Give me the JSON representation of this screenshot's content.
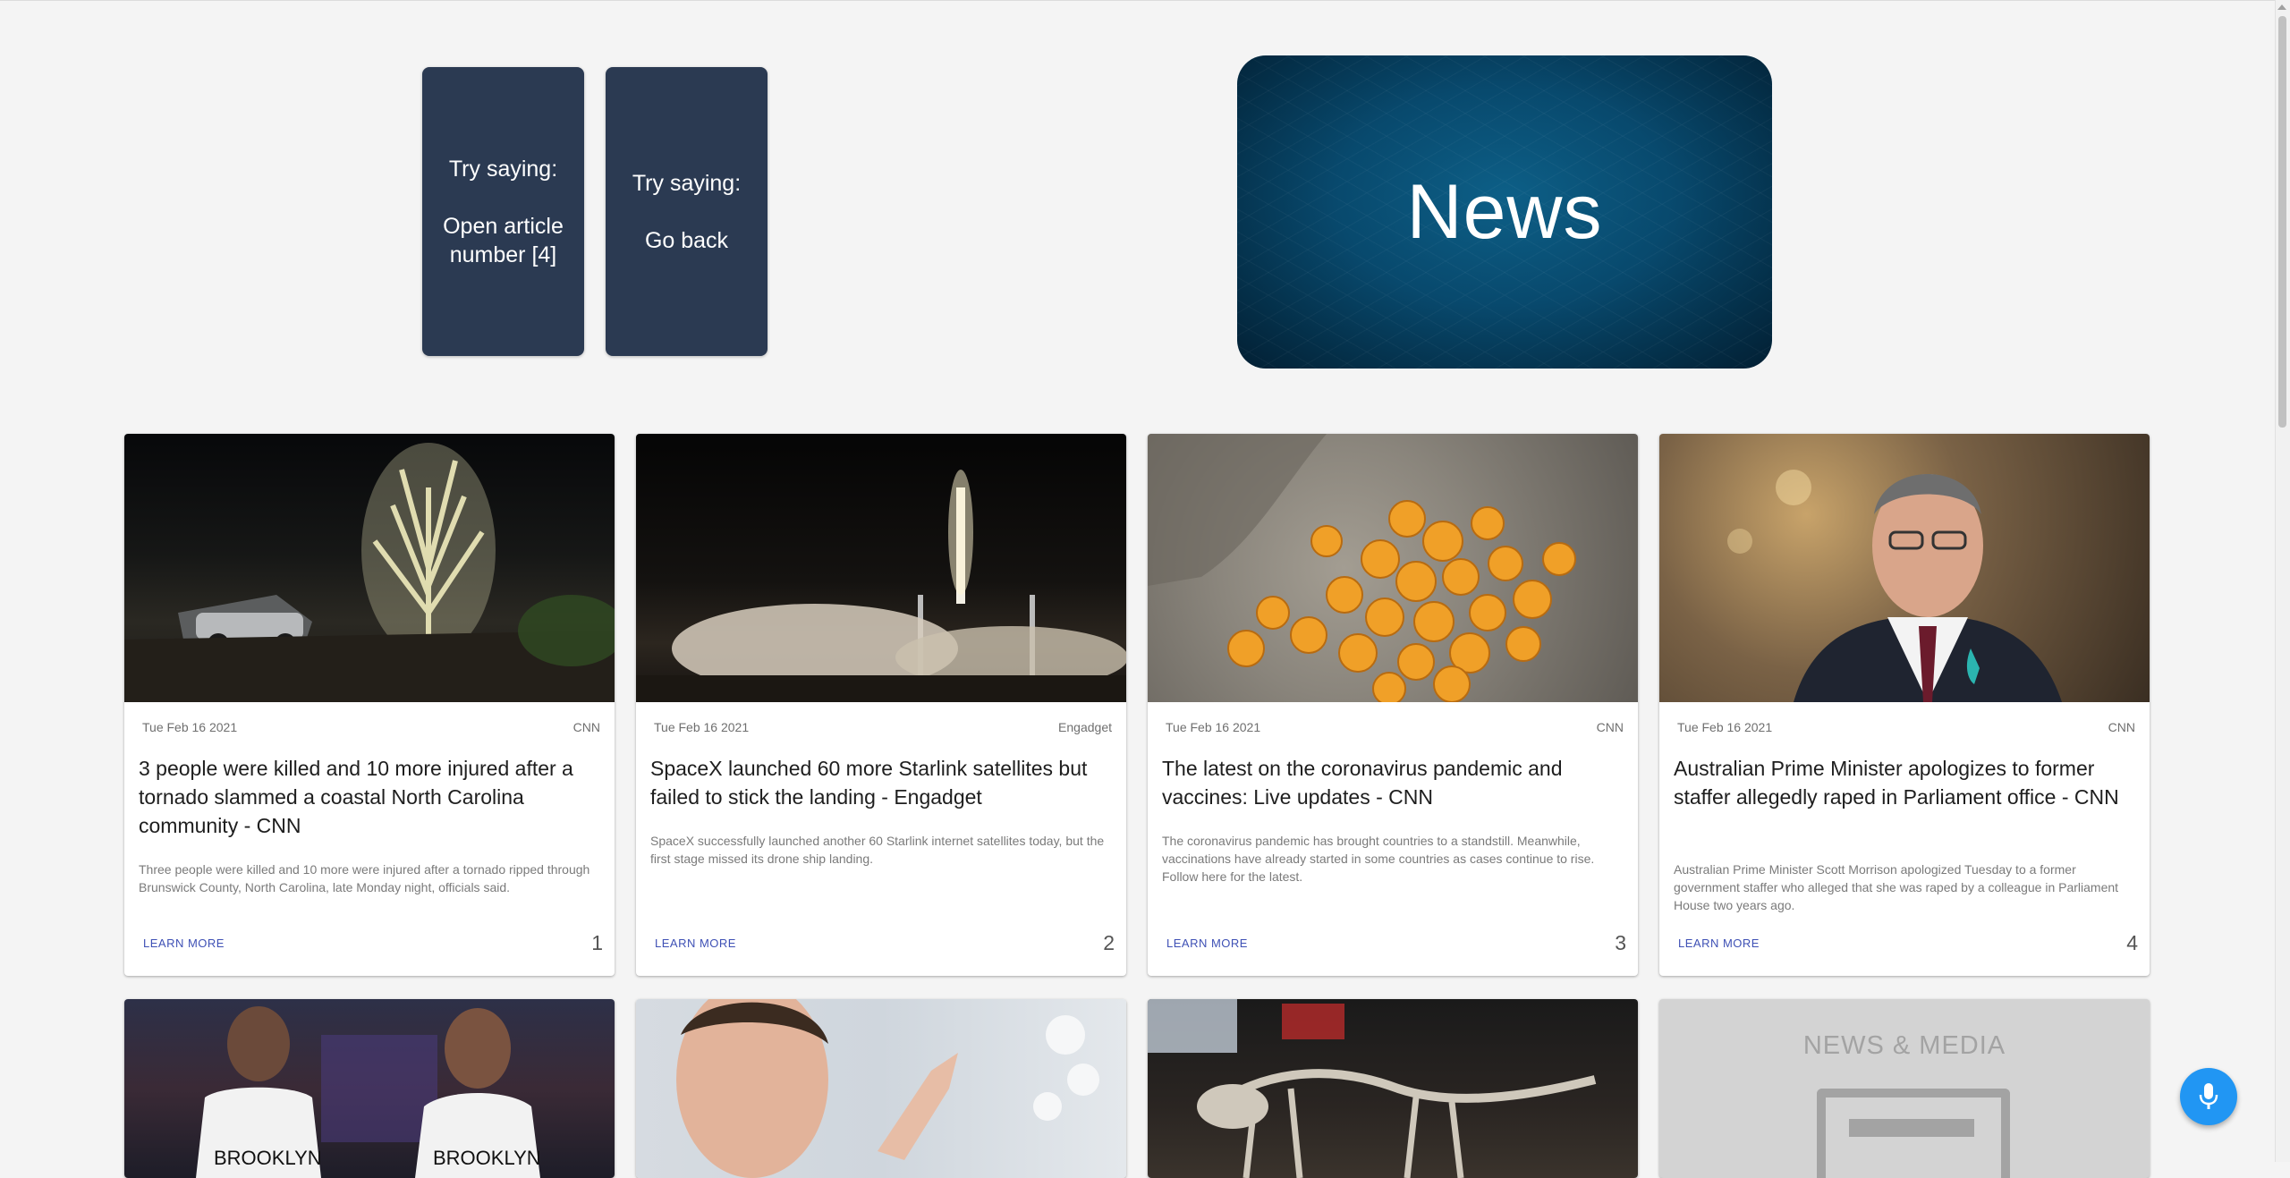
{
  "hints": [
    {
      "heading": "Try saying:",
      "phrase": "Open article number [4]"
    },
    {
      "heading": "Try saying:",
      "phrase": "Go back"
    }
  ],
  "banner": {
    "title": "News"
  },
  "articles": [
    {
      "date": "Tue Feb 16 2021",
      "source": "CNN",
      "title": "3 people were killed and 10 more injured after a tornado slammed a coastal North Carolina community - CNN",
      "description": "Three people were killed and 10 more were injured after a tornado ripped through Brunswick County, North Carolina, late Monday night, officials said.",
      "action": "LEARN MORE",
      "number": "1",
      "image_icon": "tornado-damage-photo"
    },
    {
      "date": "Tue Feb 16 2021",
      "source": "Engadget",
      "title": "SpaceX launched 60 more Starlink satellites but failed to stick the landing - Engadget",
      "description": "SpaceX successfully launched another 60 Starlink internet satellites today, but the first stage missed its drone ship landing.",
      "action": "LEARN MORE",
      "number": "2",
      "image_icon": "rocket-launch-photo"
    },
    {
      "date": "Tue Feb 16 2021",
      "source": "CNN",
      "title": "The latest on the coronavirus pandemic and vaccines: Live updates - CNN",
      "description": "The coronavirus pandemic has brought countries to a standstill. Meanwhile, vaccinations have already started in some countries as cases continue to rise. Follow here for the latest.",
      "action": "LEARN MORE",
      "number": "3",
      "image_icon": "coronavirus-photo"
    },
    {
      "date": "Tue Feb 16 2021",
      "source": "CNN",
      "title": "Australian Prime Minister apologizes to former staffer allegedly raped in Parliament office - CNN",
      "description": "Australian Prime Minister Scott Morrison apologized Tuesday to a former government staffer who alleged that she was raped by a colleague in Parliament House two years ago.",
      "action": "LEARN MORE",
      "number": "4",
      "image_icon": "prime-minister-photo"
    }
  ],
  "placeholder_card": {
    "text": "NEWS & MEDIA"
  },
  "colors": {
    "hint_bg": "#2b3a52",
    "accent": "#3f51b5",
    "fab": "#2196f3",
    "page_bg": "#f4f4f4"
  },
  "fab": {
    "icon": "microphone-icon"
  }
}
